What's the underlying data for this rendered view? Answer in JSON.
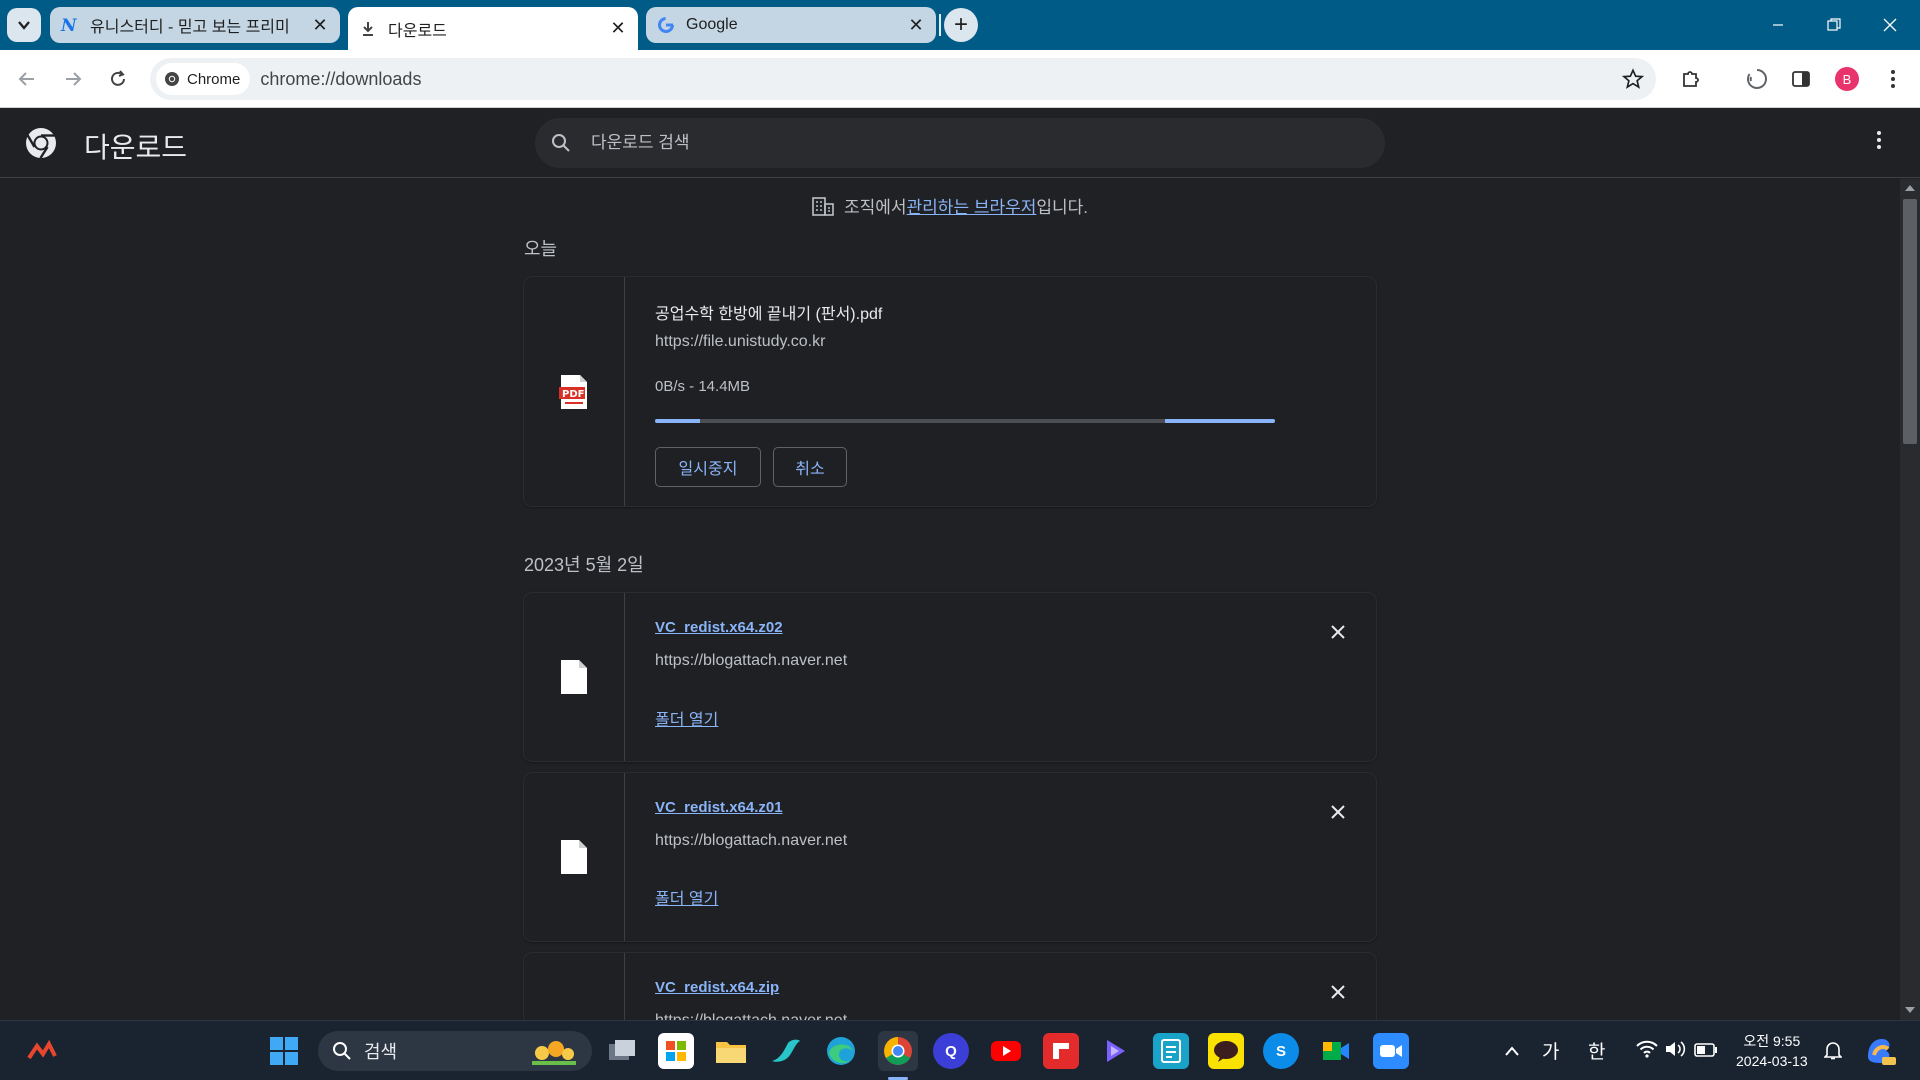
{
  "browser": {
    "tabs": [
      {
        "title": "유니스터디 - 믿고 보는 프리미",
        "active": false
      },
      {
        "title": "다운로드",
        "active": true
      },
      {
        "title": "Google",
        "active": false
      }
    ],
    "omnibox": {
      "chip_label": "Chrome",
      "url": "chrome://downloads"
    },
    "profile_initial": "B"
  },
  "downloads": {
    "title": "다운로드",
    "search_placeholder": "다운로드 검색",
    "managed_prefix": "조직에서 ",
    "managed_link": "관리하는 브라우저",
    "managed_suffix": "입니다.",
    "groups": [
      {
        "date": "오늘",
        "items": [
          {
            "name": "공업수학 한방에 끝내기 (판서).pdf",
            "source": "https://file.unistudy.co.kr",
            "status": "0B/s - 14.4MB",
            "pause_label": "일시중지",
            "cancel_label": "취소"
          }
        ]
      },
      {
        "date": "2023년 5월 2일",
        "items": [
          {
            "name": "VC_redist.x64.z02",
            "source": "https://blogattach.naver.net",
            "open_label": "폴더 열기"
          },
          {
            "name": "VC_redist.x64.z01",
            "source": "https://blogattach.naver.net",
            "open_label": "폴더 열기"
          },
          {
            "name": "VC_redist.x64.zip",
            "source": "https://blogattach.naver.net"
          }
        ]
      }
    ]
  },
  "taskbar": {
    "search_label": "검색",
    "ime_lang": "가",
    "ime_mode": "한",
    "time": "오전 9:55",
    "date": "2024-03-13"
  },
  "colors": {
    "tabstrip": "#005b87",
    "page_bg": "#202124",
    "link": "#8ab4f8",
    "taskbar": "#1a2330"
  }
}
